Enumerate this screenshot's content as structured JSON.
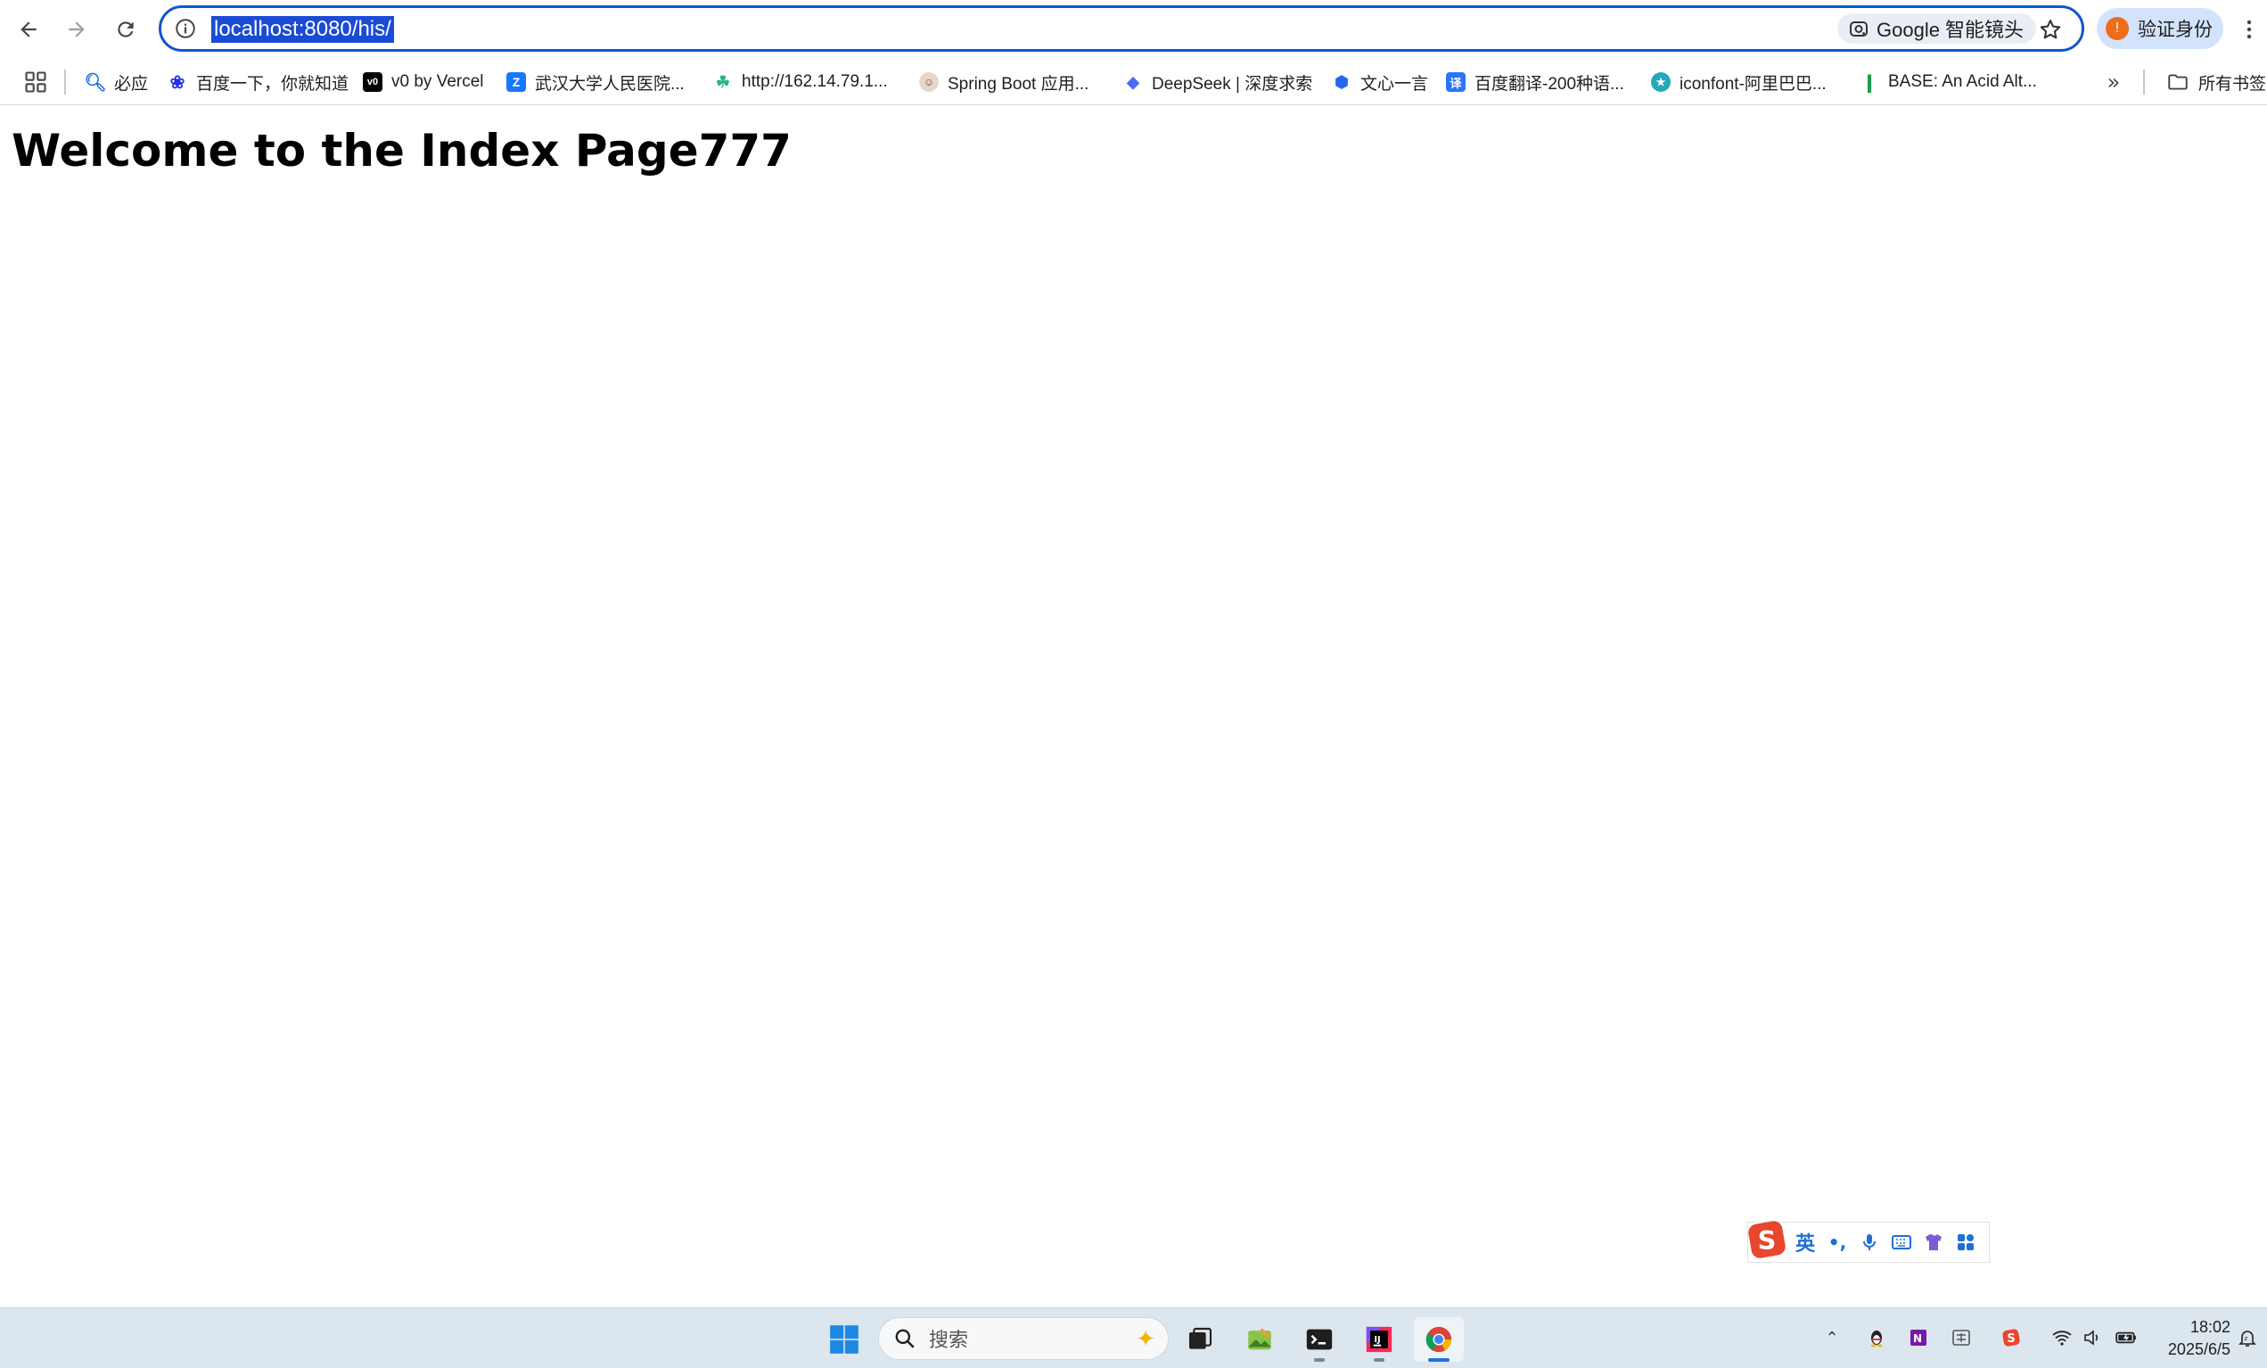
{
  "browser": {
    "url": "localhost:8080/his/",
    "lens_label": "Google 智能镜头",
    "profile_label": "验证身份",
    "profile_initial": "!"
  },
  "bookmarks": {
    "items": [
      {
        "label": "必应",
        "icon": "search-icon",
        "color": "#1a73e8"
      },
      {
        "label": "百度一下，你就知道",
        "icon": "baidu-paw-icon",
        "color": "#2932e1"
      },
      {
        "label": "v0 by Vercel",
        "icon": "v0-icon",
        "color": "#000000"
      },
      {
        "label": "武汉大学人民医院...",
        "icon": "zhihu-like-icon",
        "color": "#1677ff"
      },
      {
        "label": "http://162.14.79.1...",
        "icon": "leaf-icon",
        "color": "#2bb389"
      },
      {
        "label": "Spring Boot 应用...",
        "icon": "avatar-icon",
        "color": "#6b4a3a"
      },
      {
        "label": "DeepSeek | 深度求索",
        "icon": "whale-icon",
        "color": "#4d6bfe"
      },
      {
        "label": "文心一言",
        "icon": "cube-icon",
        "color": "#2468f2"
      },
      {
        "label": "百度翻译-200种语...",
        "icon": "translate-icon",
        "color": "#2a75f6"
      },
      {
        "label": "iconfont-阿里巴巴...",
        "icon": "iconfont-icon",
        "color": "#27a8b8"
      },
      {
        "label": "BASE: An Acid Alt...",
        "icon": "bookmark-pin-icon",
        "color": "#1e9e4a"
      }
    ],
    "all_bookmarks_label": "所有书签"
  },
  "page": {
    "heading": "Welcome to the Index Page777"
  },
  "ime": {
    "lang_label": "英",
    "punct_label": "•,",
    "brand_color": "#e8462e"
  },
  "taskbar": {
    "search_placeholder": "搜索",
    "time": "18:02",
    "date": "2025/6/5"
  }
}
